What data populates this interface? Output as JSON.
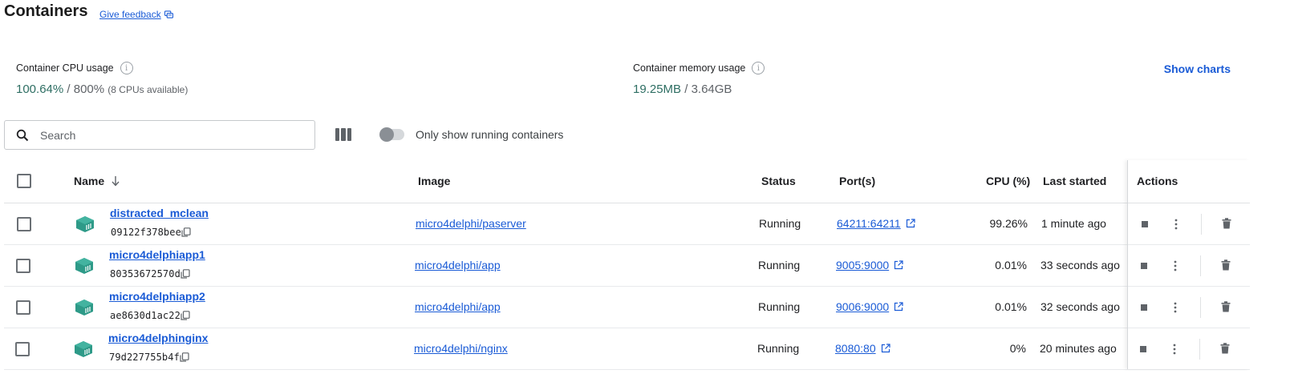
{
  "header": {
    "title": "Containers",
    "feedback_label": "Give feedback"
  },
  "stats": {
    "cpu": {
      "label": "Container CPU usage",
      "used": "100.64%",
      "sep": " / ",
      "total": "800%",
      "note": "(8 CPUs available)"
    },
    "memory": {
      "label": "Container memory usage",
      "used": "19.25MB",
      "sep": " / ",
      "total": "3.64GB"
    },
    "show_charts_label": "Show charts"
  },
  "toolbar": {
    "search_placeholder": "Search",
    "only_running_label": "Only show running containers",
    "only_running_enabled": false
  },
  "table": {
    "columns": {
      "name": "Name",
      "image": "Image",
      "status": "Status",
      "ports": "Port(s)",
      "cpu": "CPU (%)",
      "last_started": "Last started",
      "actions": "Actions"
    },
    "sort": {
      "column": "name",
      "direction": "descending-arrow"
    },
    "rows": [
      {
        "name": "distracted_mclean",
        "id": "09122f378bee",
        "image": "micro4delphi/paserver",
        "status": "Running",
        "ports": "64211:64211",
        "cpu": "99.26%",
        "last_started": "1 minute ago"
      },
      {
        "name": "micro4delphiapp1",
        "id": "80353672570d",
        "image": "micro4delphi/app",
        "status": "Running",
        "ports": "9005:9000",
        "cpu": "0.01%",
        "last_started": "33 seconds ago"
      },
      {
        "name": "micro4delphiapp2",
        "id": "ae8630d1ac22",
        "image": "micro4delphi/app",
        "status": "Running",
        "ports": "9006:9000",
        "cpu": "0.01%",
        "last_started": "32 seconds ago"
      },
      {
        "name": "micro4delphinginx",
        "id": "79d227755b4f",
        "image": "micro4delphi/nginx",
        "status": "Running",
        "ports": "8080:80",
        "cpu": "0%",
        "last_started": "20 minutes ago"
      }
    ]
  },
  "icons": {
    "container": "container-icon",
    "copy": "copy-icon",
    "external_link": "external-link-icon",
    "stop": "stop-icon",
    "more": "more-vert-icon",
    "delete": "trash-icon"
  },
  "colors": {
    "link": "#1a5bd6",
    "stat_value": "#2e6e63",
    "container_icon": "#2e9a88"
  }
}
